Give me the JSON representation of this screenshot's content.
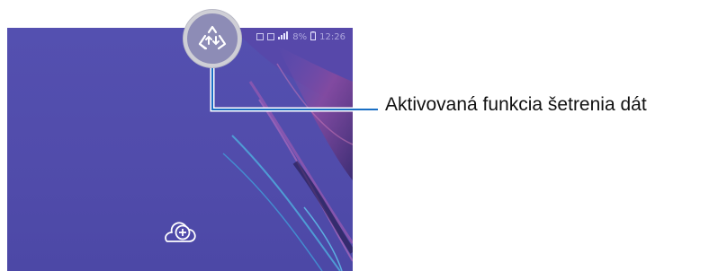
{
  "callout": {
    "label": "Aktivovaná funkcia šetrenia dát"
  },
  "statusbar": {
    "battery_percent": "8%",
    "time": "12:26"
  },
  "icons": {
    "data_saver": "data-saver-icon",
    "cloud_add": "cloud-add-icon"
  },
  "colors": {
    "screen_background": "#5450b0",
    "callout_line": "#1a6fc4",
    "zoom_circle_fill": "#8d8cb6",
    "zoom_circle_border": "#cfcfd6"
  }
}
